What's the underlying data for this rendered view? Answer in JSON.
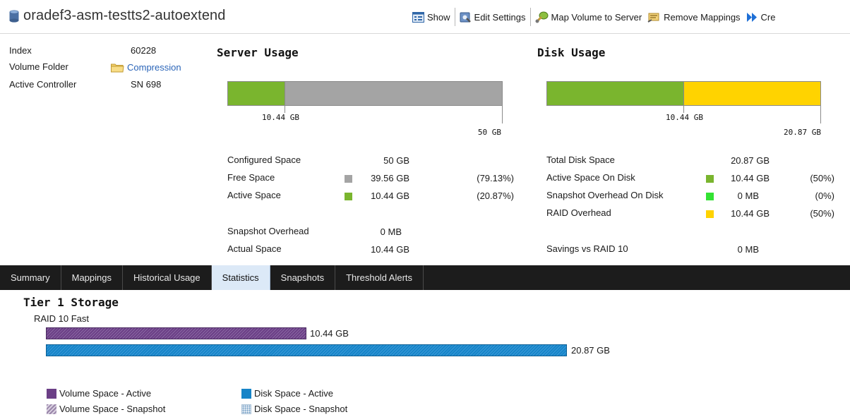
{
  "header": {
    "title": "oradef3-asm-testts2-autoextend",
    "toolbar": [
      {
        "label": "Show",
        "icon": "show-icon"
      },
      {
        "label": "Edit Settings",
        "icon": "edit-settings-icon"
      },
      {
        "label": "Map Volume to Server",
        "icon": "map-volume-icon"
      },
      {
        "label": "Remove Mappings",
        "icon": "remove-mappings-icon"
      },
      {
        "label": "Cre",
        "icon": "create-icon"
      }
    ]
  },
  "info": {
    "index_label": "Index",
    "index_value": "60228",
    "folder_label": "Volume Folder",
    "folder_value": "Compression",
    "controller_label": "Active Controller",
    "controller_value": "SN 698"
  },
  "server_usage": {
    "title": "Server Usage",
    "bar": {
      "used_fraction": 0.2087,
      "used_color": "#7ab52e",
      "free_color": "#a4a4a4"
    },
    "tick_used": "10.44 GB",
    "tick_max": "50 GB",
    "rows": [
      {
        "label": "Configured Space",
        "value": "50 GB",
        "pct": ""
      },
      {
        "label": "Free Space",
        "value": "39.56 GB",
        "pct": "(79.13%)",
        "color": "#a4a4a4"
      },
      {
        "label": "Active Space",
        "value": "10.44 GB",
        "pct": "(20.87%)",
        "color": "#7ab52e"
      },
      {
        "label": "Snapshot Overhead",
        "value": "0 MB",
        "pct": ""
      },
      {
        "label": "Actual Space",
        "value": "10.44 GB",
        "pct": ""
      }
    ]
  },
  "disk_usage": {
    "title": "Disk Usage",
    "bar": {
      "active_fraction": 0.5,
      "active_color": "#7ab52e",
      "raid_color": "#ffd300"
    },
    "tick_used": "10.44 GB",
    "tick_max": "20.87 GB",
    "rows": [
      {
        "label": "Total Disk Space",
        "value": "20.87 GB",
        "pct": ""
      },
      {
        "label": "Active Space On Disk",
        "value": "10.44 GB",
        "pct": "(50%)",
        "color": "#7ab52e"
      },
      {
        "label": "Snapshot Overhead On Disk",
        "value": "0 MB",
        "pct": "(0%)",
        "color": "#33e233"
      },
      {
        "label": "RAID Overhead",
        "value": "10.44 GB",
        "pct": "(50%)",
        "color": "#ffd300"
      },
      {
        "label": "Savings vs RAID 10",
        "value": "0 MB",
        "pct": ""
      }
    ]
  },
  "tabs": [
    "Summary",
    "Mappings",
    "Historical Usage",
    "Statistics",
    "Snapshots",
    "Threshold Alerts"
  ],
  "active_tab": "Statistics",
  "storage": {
    "tier_title": "Tier 1 Storage",
    "raid_label": "RAID 10 Fast",
    "volume_bar": {
      "value": "10.44 GB",
      "fraction": 0.5003,
      "color": "#6b3f86"
    },
    "disk_bar": {
      "value": "20.87 GB",
      "fraction": 1.0,
      "color": "#1684c8"
    },
    "legend": [
      {
        "label": "Volume Space - Active",
        "color": "#6b3f86",
        "pattern": "solid"
      },
      {
        "label": "Volume Space - Snapshot",
        "color": "#9a86aa",
        "pattern": "hatch"
      },
      {
        "label": "Disk Space - Active",
        "color": "#1684c8",
        "pattern": "solid"
      },
      {
        "label": "Disk Space - Snapshot",
        "color": "#8fb6d6",
        "pattern": "dots"
      }
    ]
  }
}
